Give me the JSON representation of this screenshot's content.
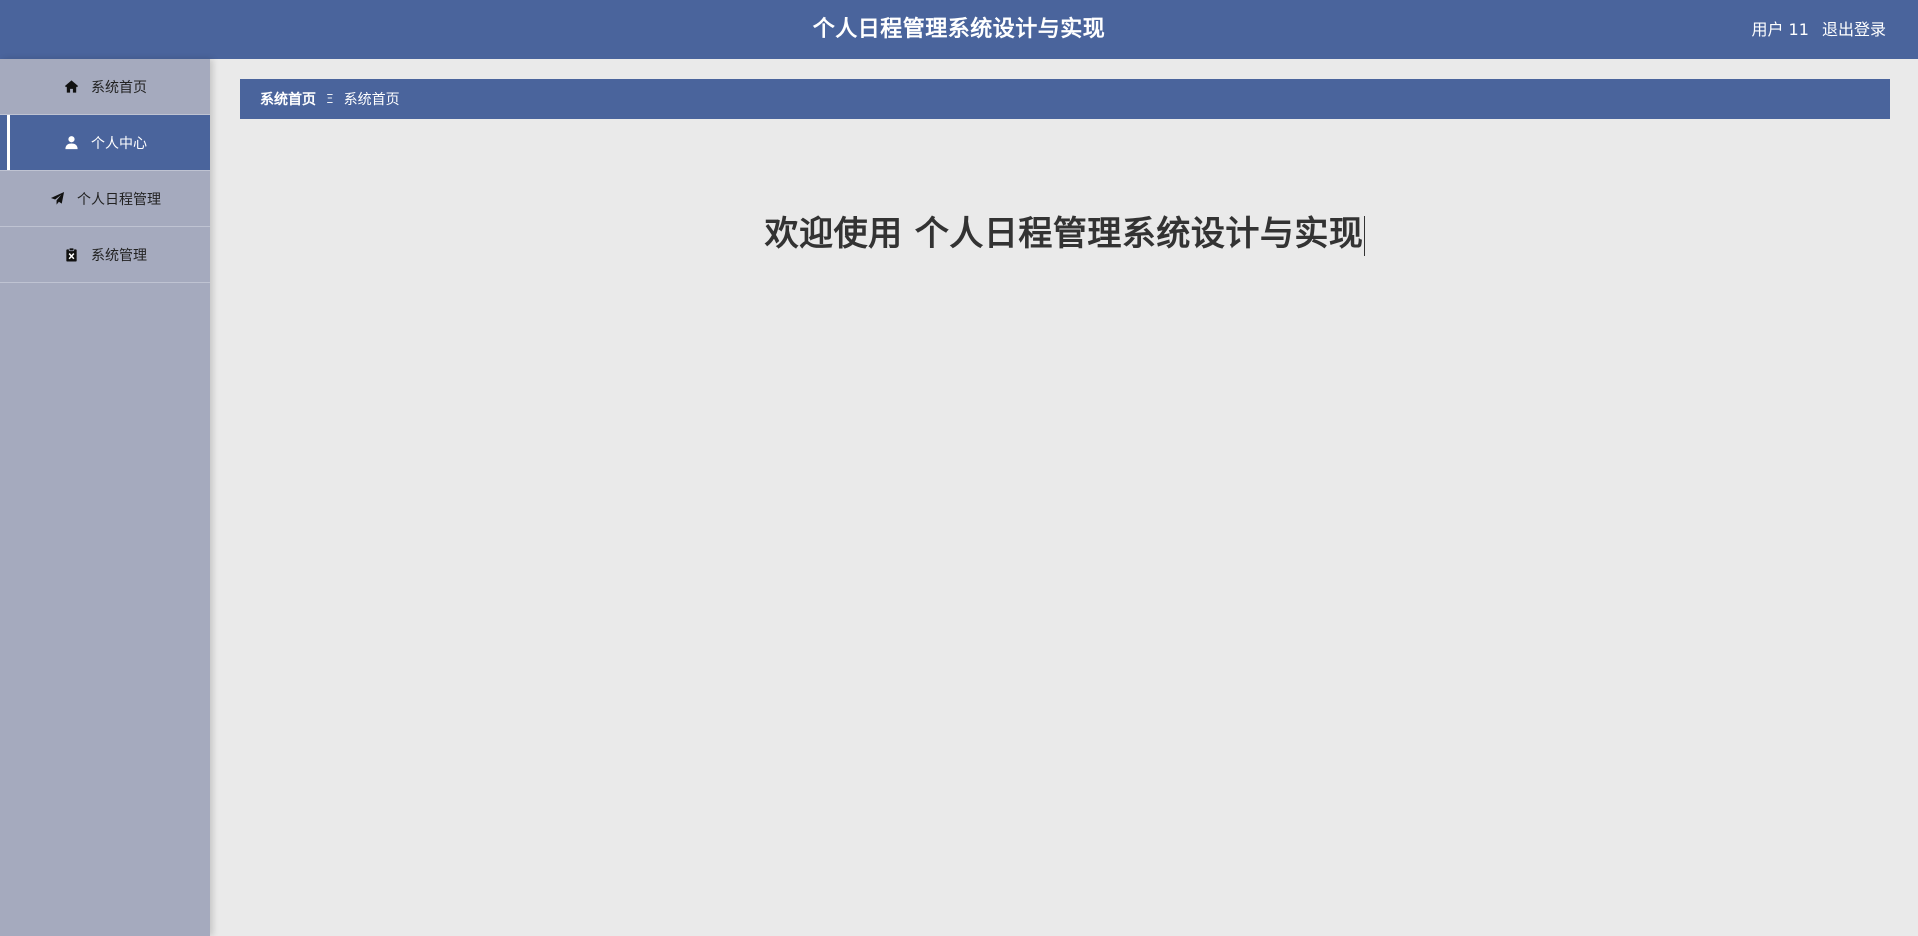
{
  "header": {
    "app_title": "个人日程管理系统设计与实现",
    "username": "用户 11",
    "logout_label": "退出登录"
  },
  "sidebar": {
    "items": [
      {
        "label": "系统首页",
        "icon": "home-icon",
        "active": false
      },
      {
        "label": "个人中心",
        "icon": "user-icon",
        "active": true
      },
      {
        "label": "个人日程管理",
        "icon": "paper-plane-icon",
        "active": false
      },
      {
        "label": "系统管理",
        "icon": "clipboard-x-icon",
        "active": false
      }
    ]
  },
  "breadcrumb": {
    "home": "系统首页",
    "separator": "Ξ",
    "current": "系统首页"
  },
  "main": {
    "welcome_text": "欢迎使用 个人日程管理系统设计与实现"
  },
  "colors": {
    "primary": "#4a649c",
    "sidebar_bg": "#a5aabe",
    "content_bg": "#eaeaea"
  }
}
